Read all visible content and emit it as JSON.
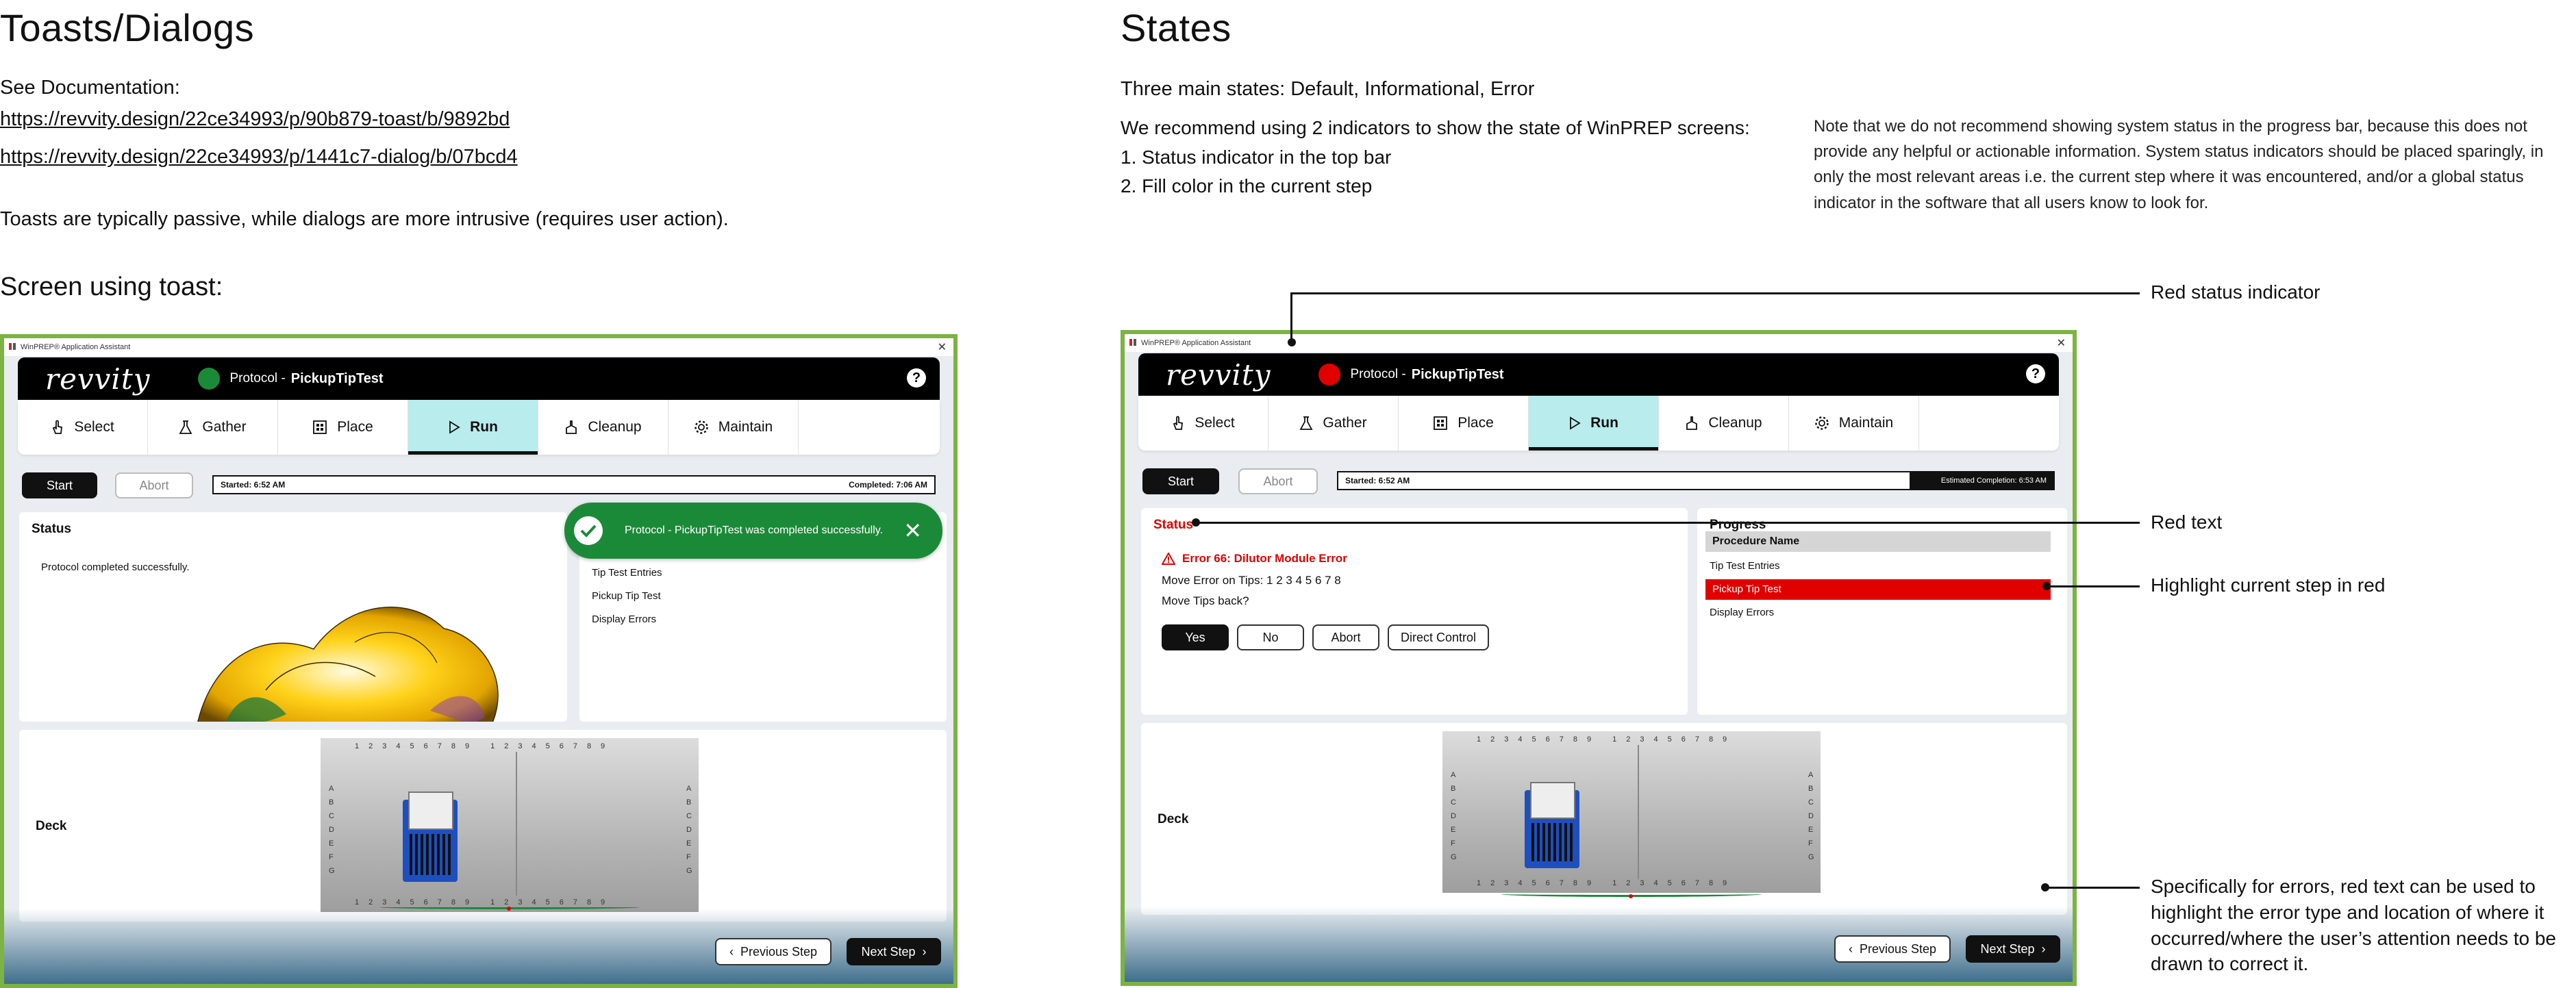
{
  "left": {
    "title": "Toasts/Dialogs",
    "see_doc": "See Documentation:",
    "links": [
      "https://revvity.design/22ce34993/p/90b879-toast/b/9892bd",
      "https://revvity.design/22ce34993/p/1441c7-dialog/b/07bcd4"
    ],
    "toast_note": "Toasts are typically passive, while dialogs are more intrusive (requires user action).",
    "screen_heading": "Screen using toast:"
  },
  "right": {
    "title": "States",
    "states_line": "Three main states: Default, Informational, Error",
    "recommend": "We recommend using 2 indicators to show the state of WinPREP screens:",
    "items": [
      "1. Status indicator in the top bar",
      "2. Fill color in the current step"
    ],
    "note": "Note that we do not recommend showing system status in the progress bar, because this does not provide any helpful or actionable information. System status indicators should be placed sparingly, in only the most relevant areas i.e. the current step where it was encountered, and/or a global status indicator in the software that all users know to look for."
  },
  "annotations": {
    "red_status": "Red status indicator",
    "red_text": "Red text",
    "highlight": "Highlight current step in red",
    "errors_note": "Specifically for errors, red text can be used to highlight the error type and location of where it occurred/where the user’s attention needs to be drawn to correct it."
  },
  "app": {
    "window_title": "WinPREP® Application Assistant",
    "logo": "revvity",
    "protocol_label": "Protocol -",
    "protocol_name": "PickupTipTest",
    "help": "?",
    "tabs": [
      "Select",
      "Gather",
      "Place",
      "Run",
      "Cleanup",
      "Maintain"
    ],
    "start": "Start",
    "abort": "Abort",
    "started": "Started: 6:52 AM",
    "completed": "Completed: 7:06 AM",
    "estimated": "Estimated Completion: 6:53 AM",
    "status_title": "Status",
    "completed_msg": "Protocol completed successfully.",
    "toast_msg": "Protocol - PickupTipTest was completed successfully.",
    "progress_title": "Progress",
    "procedure_name": "Procedure Name",
    "steps": [
      "Tip Test Entries",
      "Pickup Tip Test",
      "Display Errors"
    ],
    "error_title": "Error 66: Dilutor Module Error",
    "move_error": "Move Error on Tips: 1 2 3 4 5 6 7 8",
    "move_back": "Move Tips back?",
    "err_buttons": [
      "Yes",
      "No",
      "Abort",
      "Direct Control"
    ],
    "deck": "Deck",
    "prev": "Previous Step",
    "next": "Next Step",
    "deck_cols": [
      "1",
      "2",
      "3",
      "4",
      "5",
      "6",
      "7",
      "8",
      "9"
    ],
    "deck_rows": [
      "A",
      "B",
      "C",
      "D",
      "E",
      "F",
      "G"
    ]
  },
  "colors": {
    "success": "#1b8a38",
    "error": "#e00000",
    "run_tab": "#b9ecec",
    "window_border": "#7cb342"
  }
}
